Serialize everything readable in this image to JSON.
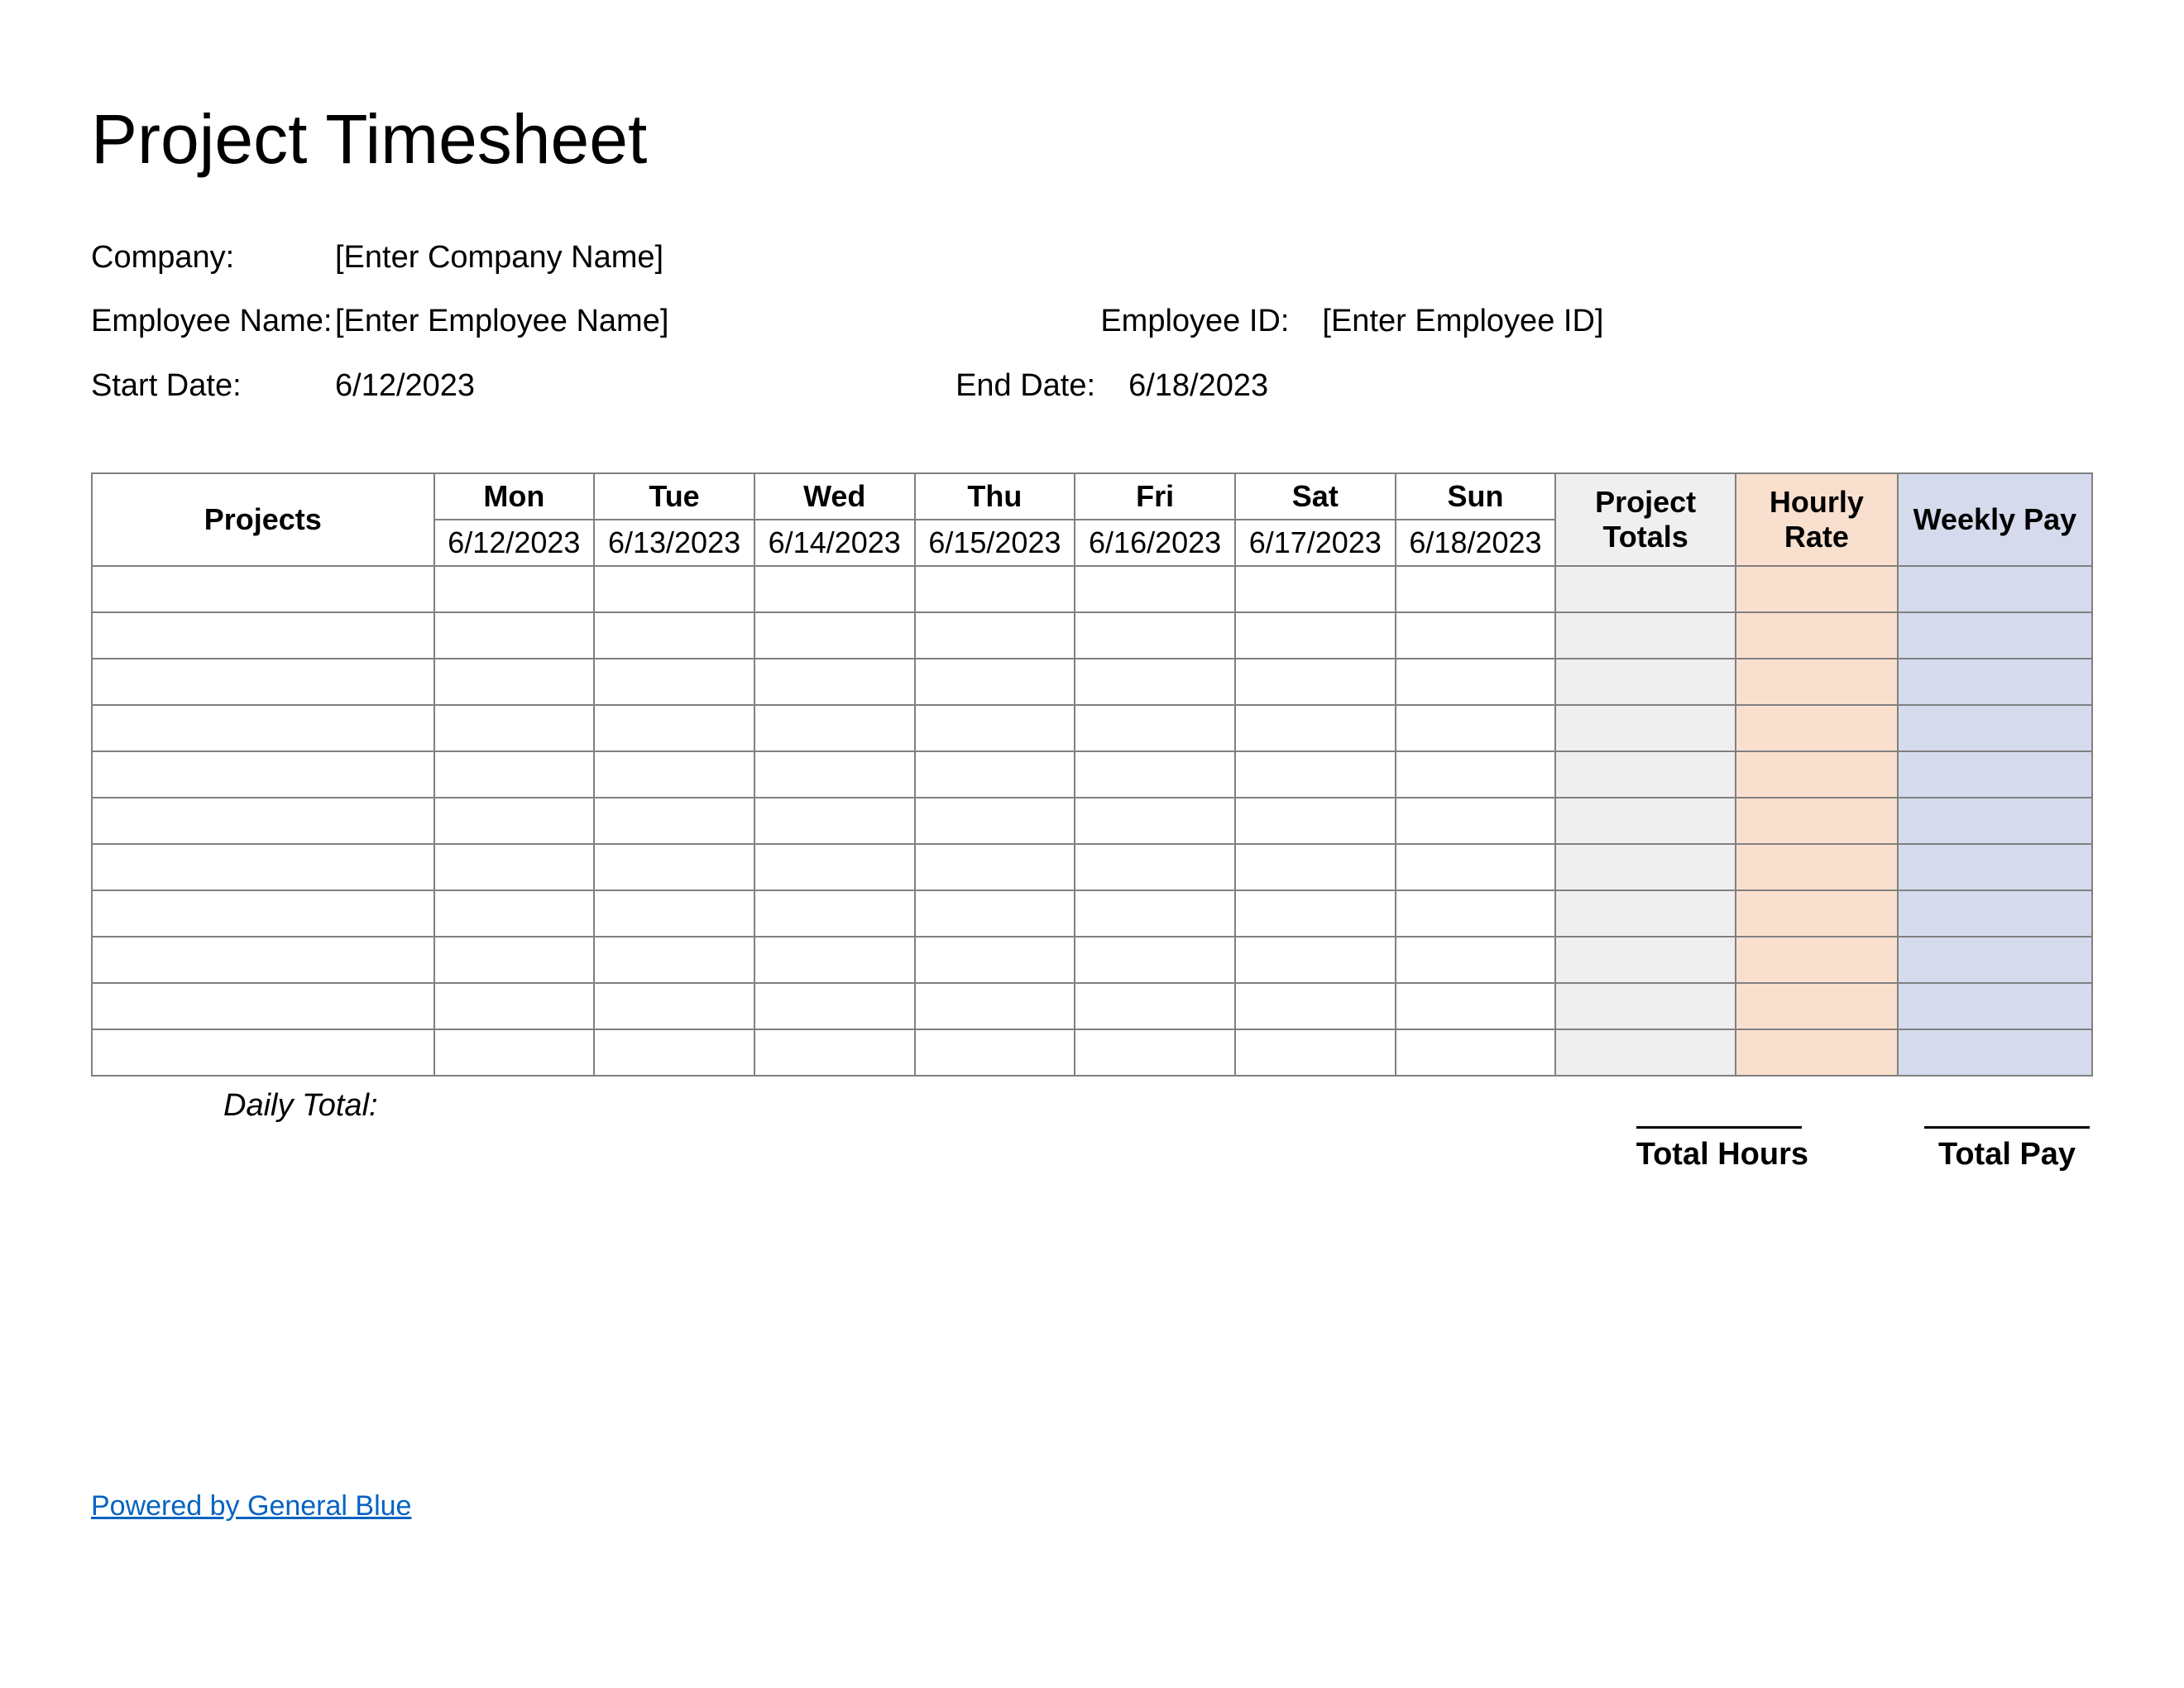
{
  "title": "Project Timesheet",
  "meta": {
    "company_label": "Company:",
    "company_value": "[Enter Company Name]",
    "employee_name_label": "Employee Name:",
    "employee_name_value": "[Enter Employee Name]",
    "employee_id_label": "Employee ID:",
    "employee_id_value": "[Enter Employee ID]",
    "start_date_label": "Start Date:",
    "start_date_value": "6/12/2023",
    "end_date_label": "End Date:",
    "end_date_value": "6/18/2023"
  },
  "table": {
    "projects_header": "Projects",
    "days": [
      {
        "name": "Mon",
        "date": "6/12/2023"
      },
      {
        "name": "Tue",
        "date": "6/13/2023"
      },
      {
        "name": "Wed",
        "date": "6/14/2023"
      },
      {
        "name": "Thu",
        "date": "6/15/2023"
      },
      {
        "name": "Fri",
        "date": "6/16/2023"
      },
      {
        "name": "Sat",
        "date": "6/17/2023"
      },
      {
        "name": "Sun",
        "date": "6/18/2023"
      }
    ],
    "project_totals_header": "Project Totals",
    "hourly_rate_header": "Hourly Rate",
    "weekly_pay_header": "Weekly Pay",
    "row_count": 11
  },
  "footer": {
    "daily_total_label": "Daily Total:",
    "total_hours_label": "Total Hours",
    "total_pay_label": "Total Pay",
    "powered_by": "Powered by General Blue"
  }
}
